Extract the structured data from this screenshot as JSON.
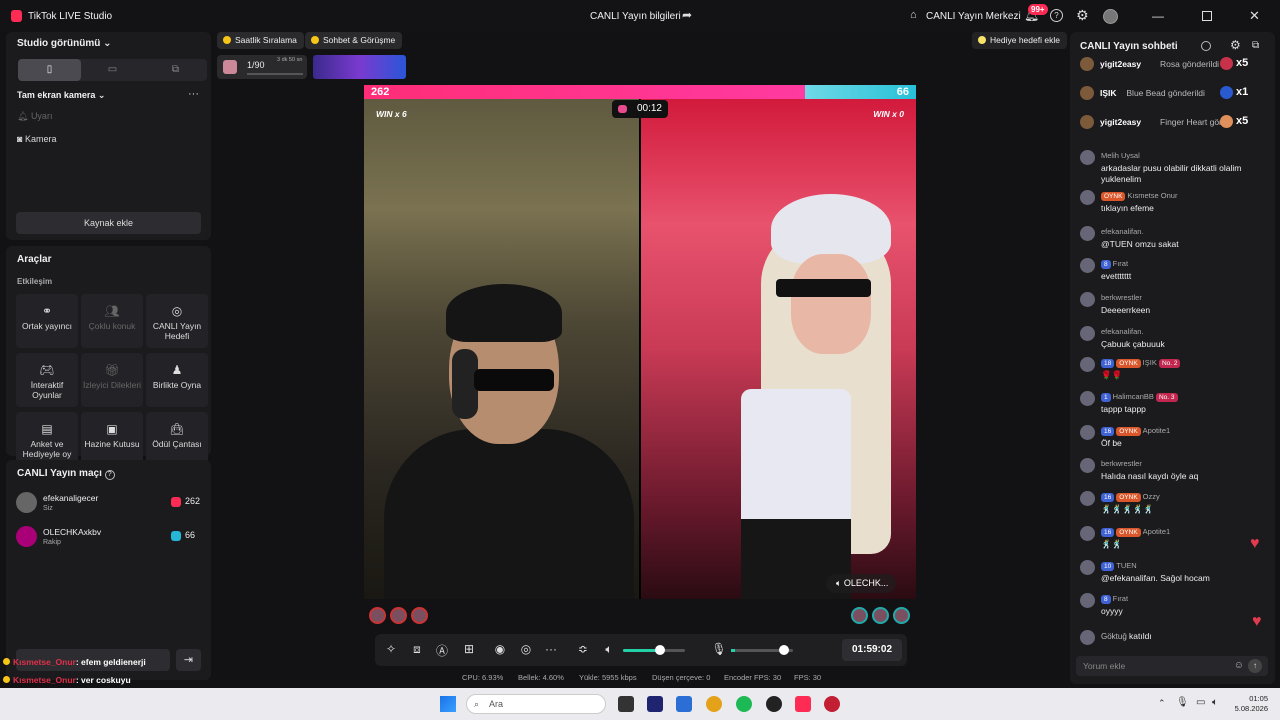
{
  "app": {
    "title": "TikTok LIVE Studio",
    "center_title": "CANLI Yayın bilgileri",
    "center_link": "CANLI Yayın Merkezi",
    "notif_count": "99+"
  },
  "studio": {
    "view_label": "Studio görünümü",
    "camera_label": "Tam ekran kamera",
    "sources": [
      "Uyarı",
      "Kamera"
    ],
    "add_source": "Kaynak ekle"
  },
  "tools": {
    "title": "Araçlar",
    "section": "Etkileşim",
    "items": [
      {
        "label": "Ortak yayıncı",
        "icon": "link-icon",
        "enabled": true
      },
      {
        "label": "Çoklu konuk",
        "icon": "users-icon",
        "enabled": false
      },
      {
        "label": "CANLI Yayın Hedefi",
        "icon": "target-icon",
        "enabled": true
      },
      {
        "label": "İnteraktif Oyunlar",
        "icon": "gamepad-icon",
        "enabled": true
      },
      {
        "label": "İzleyici Dilekleri",
        "icon": "gift-icon",
        "enabled": false
      },
      {
        "label": "Birlikte Oyna",
        "icon": "joystick-icon",
        "enabled": true
      },
      {
        "label": "Anket ve Hediyeyle oy",
        "icon": "poll-icon",
        "enabled": true
      },
      {
        "label": "Hazine Kutusu",
        "icon": "treasure-icon",
        "enabled": true
      },
      {
        "label": "Ödül Çantası",
        "icon": "bag-icon",
        "enabled": true
      }
    ]
  },
  "match": {
    "title": "CANLI Yayın maçı",
    "players": [
      {
        "name": "efekanaligecer",
        "sub": "Siz",
        "score": "262"
      },
      {
        "name": "OLECHKAxkbv",
        "sub": "Rakip",
        "score": "66"
      }
    ]
  },
  "topbar": {
    "ranking": "Saatlik Sıralama",
    "chat": "Sohbet & Görüşme",
    "goal_progress": "1/90",
    "goal_time": "3 dk 50 sn",
    "gift_goal": "Hediye hedefi ekle"
  },
  "battle": {
    "score_left": "262",
    "score_right": "66",
    "win_left": "WIN x 6",
    "win_right": "WIN x 0",
    "timer": "00:12",
    "opponent_tag": "OLECHK...",
    "left_share": 0.7998
  },
  "controls": {
    "time": "01:59:02",
    "volume": 0.6,
    "mic": 0.85
  },
  "stats": [
    {
      "label": "CPU:",
      "value": "6.93%"
    },
    {
      "label": "Bellek:",
      "value": "4.60%"
    },
    {
      "label": "Yükle:",
      "value": "5955 kbps"
    },
    {
      "label": "Düşen çerçeve:",
      "value": "0"
    },
    {
      "label": "Encoder FPS:",
      "value": "30"
    },
    {
      "label": "FPS:",
      "value": "30"
    }
  ],
  "chat_panel": {
    "title": "CANLI Yayın sohbeti",
    "gifts": [
      {
        "user": "yigit2easy",
        "text": "Rosa gönderildi",
        "count": "x5"
      },
      {
        "user": "IŞIK",
        "text": "Blue Bead gönderildi",
        "count": "x1"
      },
      {
        "user": "yigit2easy",
        "text": "Finger Heart gönde",
        "count": "x5"
      }
    ],
    "messages": [
      {
        "meta": "Melih Uysal",
        "text": "arkadaslar pusu olabilir dikkatli olalim yuklenelim"
      },
      {
        "meta": "Kısmetse Onur",
        "badge": "OYNK",
        "text": "tıklayın efeme"
      },
      {
        "meta": "efekanalifan.",
        "text": "@TUEN omzu sakat"
      },
      {
        "meta": "Fırat",
        "level": "8",
        "text": "evettttttt"
      },
      {
        "meta": "berkwrestler",
        "text": "Deeeerrkeen"
      },
      {
        "meta": "efekanalifan.",
        "text": "Çabuuk çabuuuk"
      },
      {
        "meta": "IŞIK",
        "level": "18",
        "badge": "OYNK",
        "rank": "No. 2",
        "text": "🌹🌹"
      },
      {
        "meta": "HalimcanBB",
        "level": "1",
        "rank": "No. 3",
        "text": "tappp tappp"
      },
      {
        "meta": "Apotite1",
        "level": "16",
        "badge": "OYNK",
        "text": "Öf be"
      },
      {
        "meta": "berkwrestler",
        "text": "Halıda nasıl kaydı öyle aq"
      },
      {
        "meta": "Ozzy",
        "level": "16",
        "badge": "OYNK",
        "text": "🕺🕺🕺🕺🕺"
      },
      {
        "meta": "Apotite1",
        "level": "16",
        "badge": "OYNK",
        "text": "🕺🕺"
      },
      {
        "meta": "TUEN",
        "level": "10",
        "text": "@efekanalifan. Sağol hocam"
      },
      {
        "meta": "Fırat",
        "level": "8",
        "text": "oyyyy"
      }
    ],
    "joined_user": "Göktuğ",
    "joined_text": "katıldı",
    "input_placeholder": "Yorum ekle"
  },
  "overlay": [
    {
      "name": "Kısmetse_Onur",
      "text": ": efem geldienerji"
    },
    {
      "name": "Kısmetse_Onur",
      "text": ": ver coskuyu"
    }
  ],
  "taskbar": {
    "search": "Ara",
    "time": "01:05",
    "date": "5.08.2026"
  }
}
